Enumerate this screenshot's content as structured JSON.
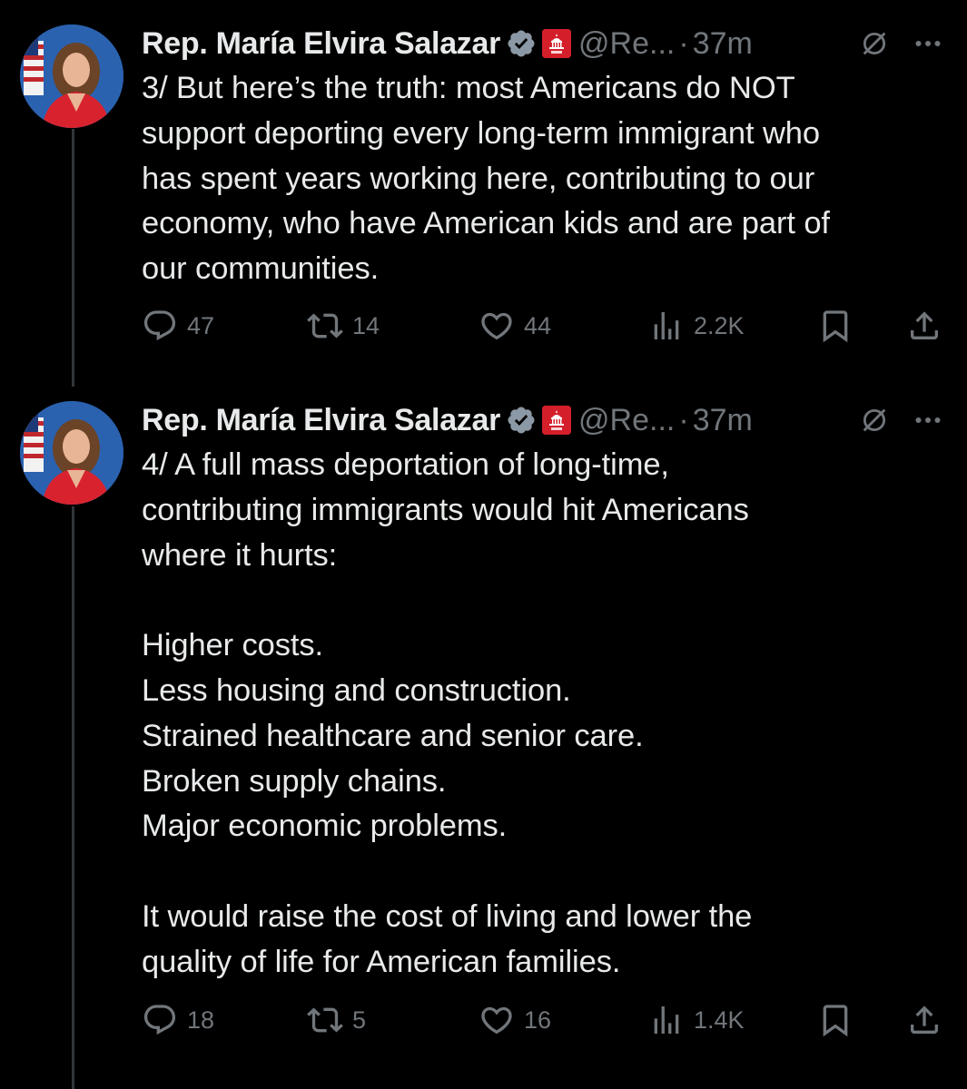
{
  "tweets": [
    {
      "author": {
        "name": "Rep. María Elvira Salazar",
        "handle": "@Re...",
        "time": "37m"
      },
      "separator": "·",
      "text": "3/ But here’s the truth: most Americans do NOT\nsupport deporting every long-term immigrant who\nhas spent years working here, contributing to our\neconomy, who have American kids and are part of\nour communities.",
      "stats": {
        "replies": "47",
        "reposts": "14",
        "likes": "44",
        "views": "2.2K"
      }
    },
    {
      "author": {
        "name": "Rep. María Elvira Salazar",
        "handle": "@Re...",
        "time": "37m"
      },
      "separator": "·",
      "text": "4/ A full mass deportation of long-time,\ncontributing immigrants would hit Americans\nwhere it hurts:\n\nHigher costs.\nLess housing and construction.\nStrained healthcare and senior care.\nBroken supply chains.\nMajor economic problems.\n\nIt would raise the cost of living and lower the\nquality of life for American families.",
      "stats": {
        "replies": "18",
        "reposts": "5",
        "likes": "16",
        "views": "1.4K"
      }
    }
  ],
  "icons": {
    "verified": "verified-badge-icon",
    "affiliate": "capitol-affiliate-icon",
    "grok": "grok-icon",
    "more": "more-dots-icon",
    "reply": "reply-icon",
    "repost": "repost-icon",
    "like": "heart-icon",
    "views": "views-chart-icon",
    "bookmark": "bookmark-icon",
    "share": "share-icon"
  },
  "colors": {
    "background": "#000000",
    "text": "#e7e9ea",
    "muted": "#71767b",
    "verified": "#1d9bf0",
    "affiliate": "#d41f2b",
    "thread_line": "#333639"
  }
}
